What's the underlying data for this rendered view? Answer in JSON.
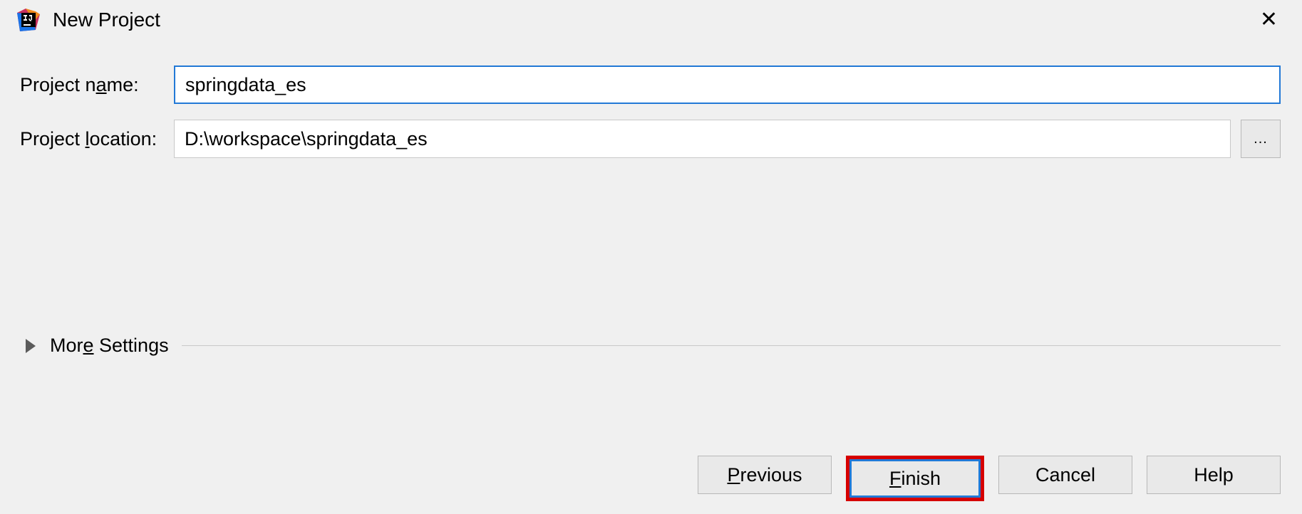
{
  "dialog": {
    "title": "New Project",
    "close_label": "✕",
    "fields": {
      "name_label_pre": "Project n",
      "name_label_u": "a",
      "name_label_post": "me:",
      "name_value": "springdata_es",
      "location_label_pre": "Project ",
      "location_label_u": "l",
      "location_label_post": "ocation:",
      "location_value": "D:\\workspace\\springdata_es",
      "browse_label": "..."
    },
    "section": {
      "label_pre": "Mor",
      "label_u": "e",
      "label_post": " Settings"
    },
    "buttons": {
      "previous_u": "P",
      "previous_post": "revious",
      "finish_u": "F",
      "finish_post": "inish",
      "cancel": "Cancel",
      "help": "Help"
    }
  }
}
